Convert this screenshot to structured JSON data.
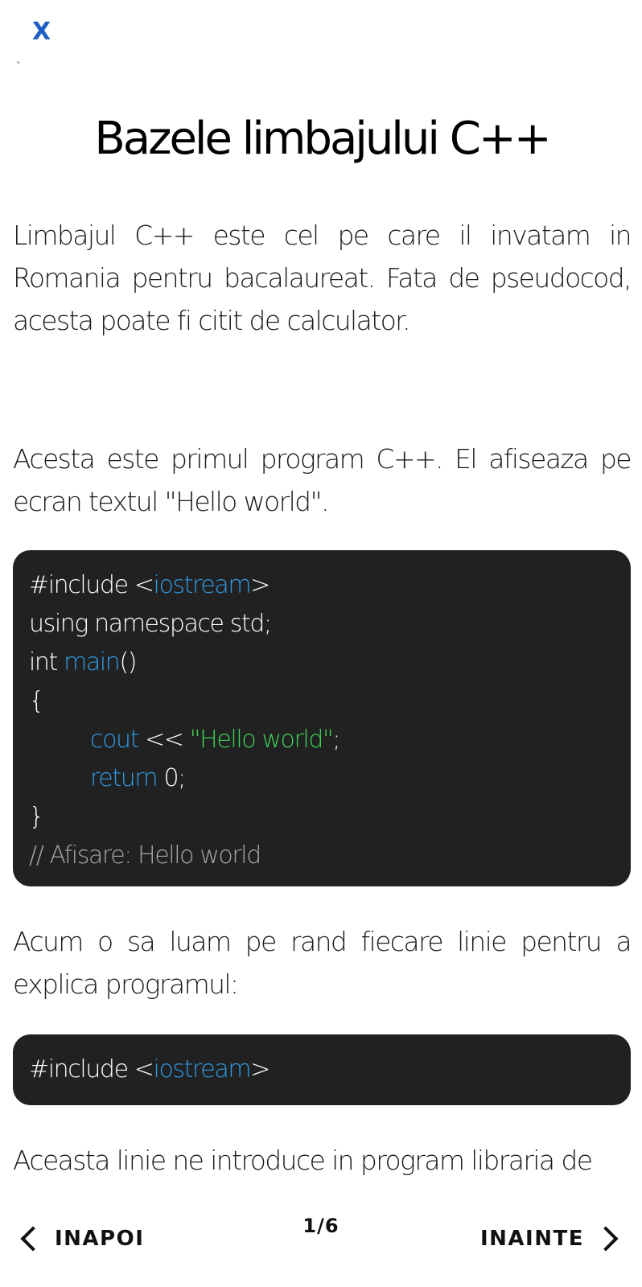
{
  "header": {
    "close_label": "X",
    "stray_mark": "`"
  },
  "lesson": {
    "title": "Bazele limbajului C++",
    "paragraph_1": "Limbajul C++ este cel pe care il invatam in Romania pentru bacalaureat. Fata de pseudocod, acesta poate fi citit de calculator.",
    "paragraph_2": "Acesta este primul program C++. El afiseaza pe ecran textul \"Hello world\".",
    "paragraph_3": "Acum o sa luam pe rand fiecare linie pentru a explica programul:",
    "paragraph_4": "Aceasta linie ne introduce in program libraria de"
  },
  "code_block_1": {
    "line1_prefix": "#include <",
    "line1_lib": "iostream",
    "line1_suffix": ">",
    "line2": "using namespace std;",
    "line3_prefix": "int ",
    "line3_func": "main",
    "line3_suffix": "()",
    "line4": "{",
    "line5_kw": "cout",
    "line5_op": " << ",
    "line5_str": "\"Hello world\"",
    "line5_end": ";",
    "line6_kw": "return",
    "line6_rest": " 0;",
    "line7": "}",
    "line8_comment": "// Afisare: Hello world"
  },
  "code_block_2": {
    "prefix": "#include <",
    "lib": "iostream",
    "suffix": ">"
  },
  "navigation": {
    "prev_label": "INAPOI",
    "next_label": "INAINTE",
    "page_indicator": "1/6"
  },
  "colors": {
    "keyword": "#2f9be6",
    "string": "#3fd35a",
    "comment": "#a7a7a7",
    "code_background": "#212121",
    "close_button": "#1f5fc2"
  }
}
